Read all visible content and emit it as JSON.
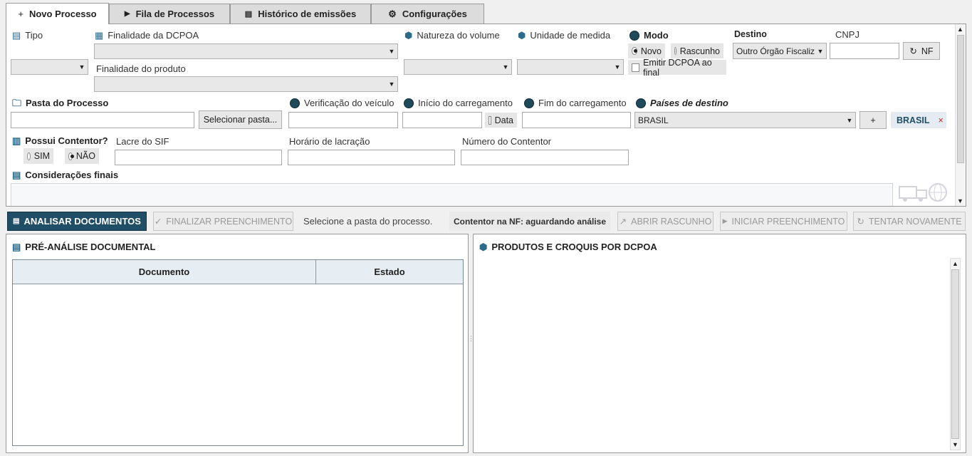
{
  "tabs": [
    {
      "label": "Novo Processo",
      "icon": "+"
    },
    {
      "label": "Fila de Processos",
      "icon": "▶"
    },
    {
      "label": "Histórico de emissões",
      "icon": "▤"
    },
    {
      "label": "Configurações",
      "icon": "⚙"
    }
  ],
  "form": {
    "tipo_label": "Tipo",
    "finalidade_dcpoa_label": "Finalidade da DCPOA",
    "finalidade_produto_label": "Finalidade do produto",
    "natureza_label": "Natureza do volume",
    "unidade_label": "Unidade de medida",
    "modo_label": "Modo",
    "modo_novo": "Novo",
    "modo_rascunho": "Rascunho",
    "emitir_label": "Emitir DCPOA ao final",
    "destino_label": "Destino",
    "destino_value": "Outro Órgão Fiscaliz",
    "cnpj_label": "CNPJ",
    "nf_button": "NF",
    "pasta_label": "Pasta do Processo",
    "selecionar_button": "Selecionar pasta...",
    "verificacao_label": "Verificação do veículo",
    "inicio_label": "Início do carregamento",
    "data_label": "Data",
    "fim_label": "Fim do carregamento",
    "paises_label": "Países de destino",
    "pais_value": "BRASIL",
    "add_button": "+",
    "pais_tag": "BRASIL",
    "pais_tag_close": "×",
    "contentor_label": "Possui Contentor?",
    "sim_label": "SIM",
    "nao_label": "NÃO",
    "lacre_label": "Lacre do SIF",
    "horario_label": "Horário de lacração",
    "numero_label": "Número do Contentor",
    "consideracoes_label": "Considerações finais"
  },
  "toolbar": {
    "analisar": "ANALISAR DOCUMENTOS",
    "finalizar": "FINALIZAR PREENCHIMENTO",
    "status": "Selecione a pasta do processo.",
    "contentor_status": "Contentor na NF: aguardando análise",
    "abrir": "ABRIR RASCUNHO",
    "iniciar": "INICIAR PREENCHIMENTO",
    "tentar": "TENTAR NOVAMENTE"
  },
  "pre_analise": {
    "title": "PRÉ-ANÁLISE DOCUMENTAL",
    "columns": [
      "Documento",
      "Estado"
    ]
  },
  "produtos": {
    "title": "PRODUTOS E CROQUIS POR DCPOA"
  },
  "colors": {
    "accent": "#1f4e66",
    "selected_tab": "#ffffff",
    "tab": "#dcdcdc"
  }
}
